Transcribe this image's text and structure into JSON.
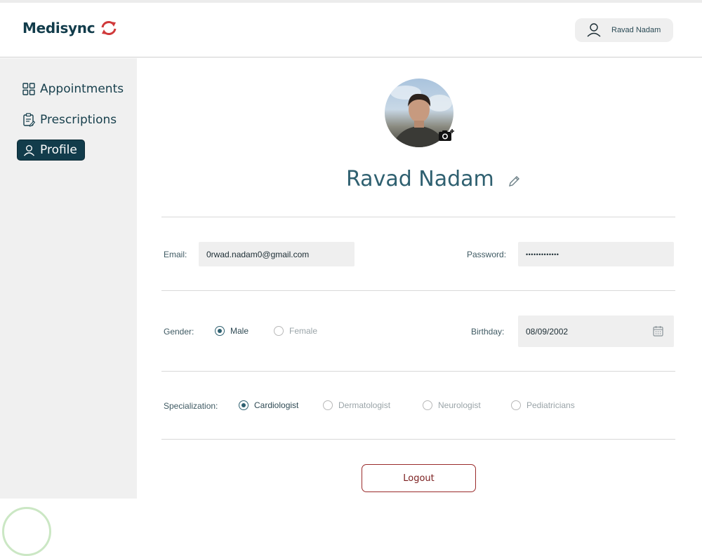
{
  "header": {
    "logo_text": "Medisync",
    "user_name": "Ravad Nadam"
  },
  "sidebar": {
    "items": [
      {
        "label": "Appointments",
        "icon": "grid-icon",
        "active": false
      },
      {
        "label": "Prescriptions",
        "icon": "clipboard-icon",
        "active": false
      },
      {
        "label": "Profile",
        "icon": "user-icon",
        "active": true
      }
    ]
  },
  "profile": {
    "name": "Ravad Nadam",
    "email_label": "Email:",
    "email_value": "0rwad.nadam0@gmail.com",
    "password_label": "Password:",
    "password_value": "•••••••••••••",
    "gender_label": "Gender:",
    "gender_options": [
      "Male",
      "Female"
    ],
    "gender_selected": "Male",
    "birthday_label": "Birthday:",
    "birthday_value": "08/09/2002",
    "specialization_label": "Specialization:",
    "specialization_options": [
      "Cardiologist",
      "Dermatologist",
      "Neurologist",
      "Pediatricians"
    ],
    "specialization_selected": "Cardiologist",
    "logout_label": "Logout"
  },
  "colors": {
    "primary": "#123c4b",
    "accent": "#2f6070",
    "logo_accent": "#d0393a",
    "logout": "#9a2b2b"
  }
}
